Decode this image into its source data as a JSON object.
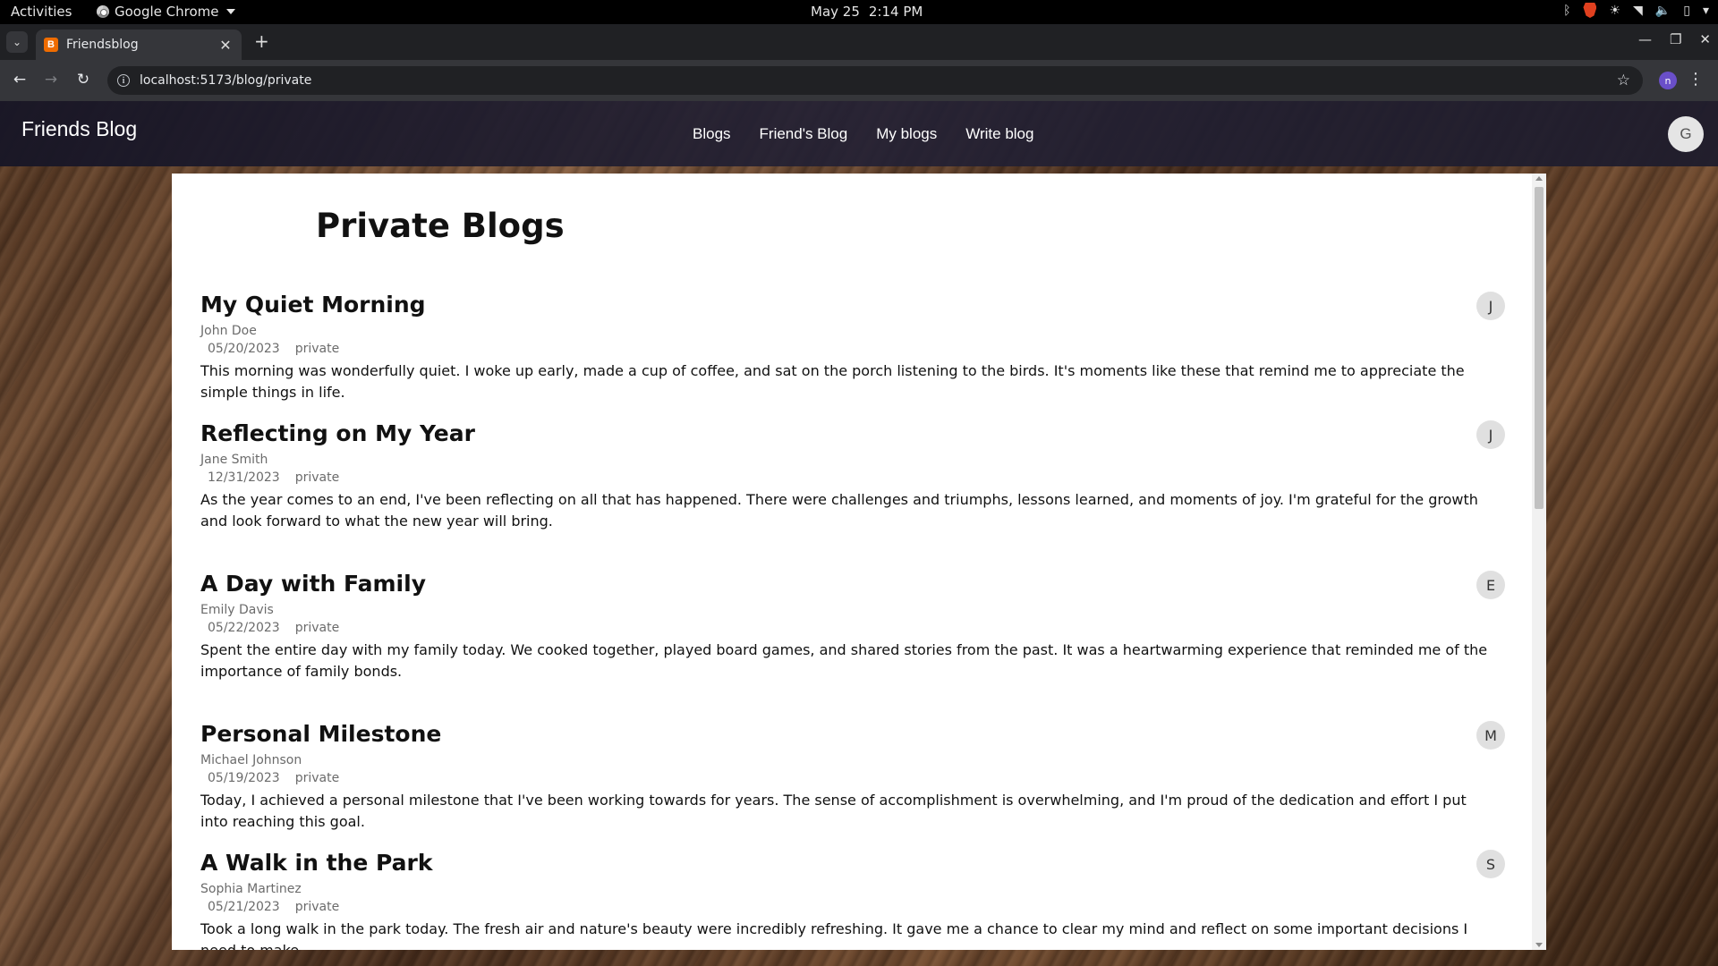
{
  "system_bar": {
    "activities": "Activities",
    "app_name": "Google Chrome",
    "date": "May 25",
    "time": "2:14 PM"
  },
  "browser": {
    "tab_title": "Friendsblog",
    "favicon_letter": "B",
    "url": "localhost:5173/blog/private",
    "profile_initial": "n"
  },
  "site": {
    "brand": "Friends Blog",
    "nav": [
      "Blogs",
      "Friend's Blog",
      "My blogs",
      "Write blog"
    ],
    "user_initial": "G"
  },
  "page": {
    "title": "Private Blogs"
  },
  "posts": [
    {
      "title": "My Quiet Morning",
      "author": "John Doe",
      "date": "05/20/2023",
      "visibility": "private",
      "body": "This morning was wonderfully quiet. I woke up early, made a cup of coffee, and sat on the porch listening to the birds. It's moments like these that remind me to appreciate the simple things in life.",
      "avatar": "J"
    },
    {
      "title": "Reflecting on My Year",
      "author": "Jane Smith",
      "date": "12/31/2023",
      "visibility": "private",
      "body": "As the year comes to an end, I've been reflecting on all that has happened. There were challenges and triumphs, lessons learned, and moments of joy. I'm grateful for the growth and look forward to what the new year will bring.",
      "avatar": "J"
    },
    {
      "title": "A Day with Family",
      "author": "Emily Davis",
      "date": "05/22/2023",
      "visibility": "private",
      "body": "Spent the entire day with my family today. We cooked together, played board games, and shared stories from the past. It was a heartwarming experience that reminded me of the importance of family bonds.",
      "avatar": "E"
    },
    {
      "title": "Personal Milestone",
      "author": "Michael Johnson",
      "date": "05/19/2023",
      "visibility": "private",
      "body": "Today, I achieved a personal milestone that I've been working towards for years. The sense of accomplishment is overwhelming, and I'm proud of the dedication and effort I put into reaching this goal.",
      "avatar": "M"
    },
    {
      "title": "A Walk in the Park",
      "author": "Sophia Martinez",
      "date": "05/21/2023",
      "visibility": "private",
      "body": "Took a long walk in the park today. The fresh air and nature's beauty were incredibly refreshing. It gave me a chance to clear my mind and reflect on some important decisions I need to make.",
      "avatar": "S"
    }
  ]
}
